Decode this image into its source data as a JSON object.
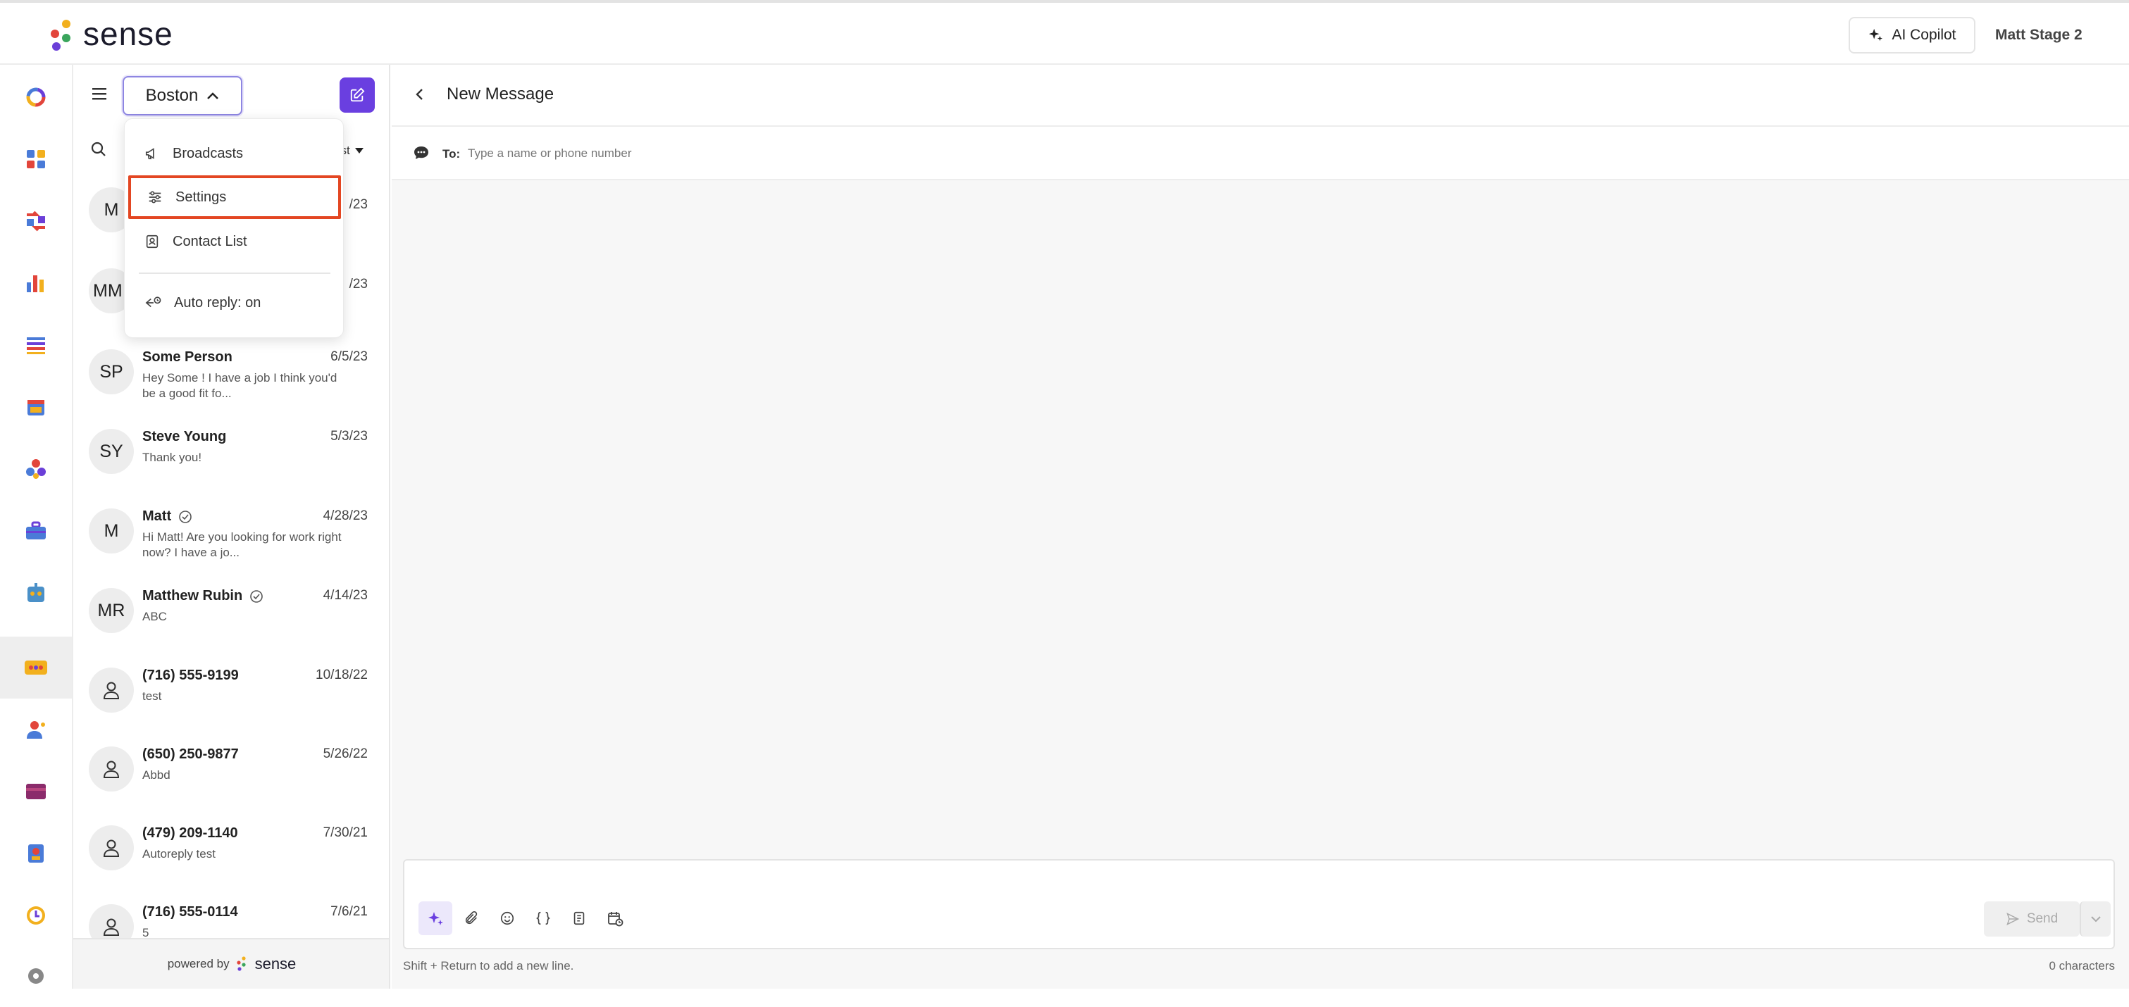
{
  "header": {
    "brand": "sense",
    "copilot_label": "AI Copilot",
    "user_name": "Matt Stage 2"
  },
  "panel": {
    "location": "Boston",
    "sort_label": "est",
    "powered_by": "powered by",
    "powered_brand": "sense"
  },
  "menu": {
    "items": [
      {
        "label": "Broadcasts",
        "icon": "megaphone-icon"
      },
      {
        "label": "Settings",
        "icon": "sliders-icon"
      },
      {
        "label": "Contact List",
        "icon": "contact-card-icon"
      },
      {
        "label": "Auto reply: on",
        "icon": "auto-reply-icon"
      }
    ]
  },
  "conversations": [
    {
      "initials": "M",
      "name": "",
      "date": "/23",
      "preview": ""
    },
    {
      "initials": "MM",
      "name": "",
      "date": "/23",
      "preview": ""
    },
    {
      "initials": "SP",
      "name": "Some Person",
      "date": "6/5/23",
      "preview": "Hey Some ! I have a job I think you'd be a good fit fo..."
    },
    {
      "initials": "SY",
      "name": "Steve Young",
      "date": "5/3/23",
      "preview": "Thank you!"
    },
    {
      "initials": "M",
      "name": "Matt",
      "date": "4/28/23",
      "preview": "Hi Matt! Are you looking for work right now? I have a jo...",
      "verified": true
    },
    {
      "initials": "MR",
      "name": "Matthew Rubin",
      "date": "4/14/23",
      "preview": "ABC",
      "verified": true
    },
    {
      "initials": "",
      "name": "(716) 555-9199",
      "date": "10/18/22",
      "preview": "test"
    },
    {
      "initials": "",
      "name": "(650) 250-9877",
      "date": "5/26/22",
      "preview": "Abbd"
    },
    {
      "initials": "",
      "name": "(479) 209-1140",
      "date": "7/30/21",
      "preview": "Autoreply test"
    },
    {
      "initials": "",
      "name": "(716) 555-0114",
      "date": "7/6/21",
      "preview": "5"
    }
  ],
  "main": {
    "title": "New Message",
    "to_label": "To:",
    "to_placeholder": "Type a name or phone number",
    "send_label": "Send",
    "hint": "Shift + Return to add a new line.",
    "char_count": "0 characters"
  },
  "colors": {
    "accent": "#6a3fe0",
    "highlight_border": "#e34622",
    "location_border": "#8e86e2"
  }
}
